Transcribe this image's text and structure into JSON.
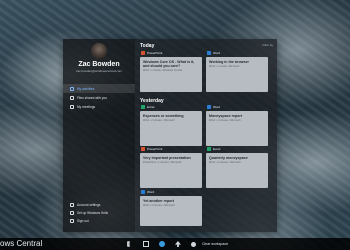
{
  "user": {
    "name": "Zac Bowden",
    "email": "zac.bowden@windowscentral.com"
  },
  "nav": {
    "items": [
      {
        "label": "My activities"
      },
      {
        "label": "Files shared with you"
      },
      {
        "label": "My meetings"
      }
    ],
    "bottom": [
      {
        "label": "Account settings"
      },
      {
        "label": "Set up Windows Hello"
      },
      {
        "label": "Sign out"
      }
    ]
  },
  "filter_label": "Filter by",
  "sections": {
    "today": "Today",
    "yesterday": "Yesterday"
  },
  "cards": [
    {
      "app": "PowerPoint",
      "title": "Windows Core OS - What is it, and should you care?",
      "meta": "Word • 1 minute • Windows Central",
      "color": "#d35230"
    },
    {
      "app": "Word",
      "title": "Working in the browser",
      "meta": "Word • 1 minute • Microsoft",
      "color": "#2b7cd3"
    },
    {
      "app": "Excel",
      "title": "Expenses or something",
      "meta": "Word • 2 minutes • Microsoft",
      "color": "#21a366"
    },
    {
      "app": "Word",
      "title": "Moneyspace report",
      "meta": "Word • 2 minutes • Microsoft",
      "color": "#2b7cd3"
    },
    {
      "app": "PowerPoint",
      "title": "Very important presentation",
      "meta": "PowerPoint • 2 minutes • Microsoft",
      "color": "#d35230"
    },
    {
      "app": "Excel",
      "title": "Quarterly moneyspace",
      "meta": "Word • 2 minutes • Microsoft",
      "color": "#21a366"
    },
    {
      "app": "Word",
      "title": "Yet another report",
      "meta": "Word • 3 minutes • Microsoft",
      "color": "#2b7cd3"
    }
  ],
  "taskbar": {
    "clear_label": "Clear workspace",
    "icons": [
      "windows-icon",
      "task-view-icon",
      "edge-icon",
      "up-arrow-icon"
    ]
  },
  "watermark": "ows Central"
}
